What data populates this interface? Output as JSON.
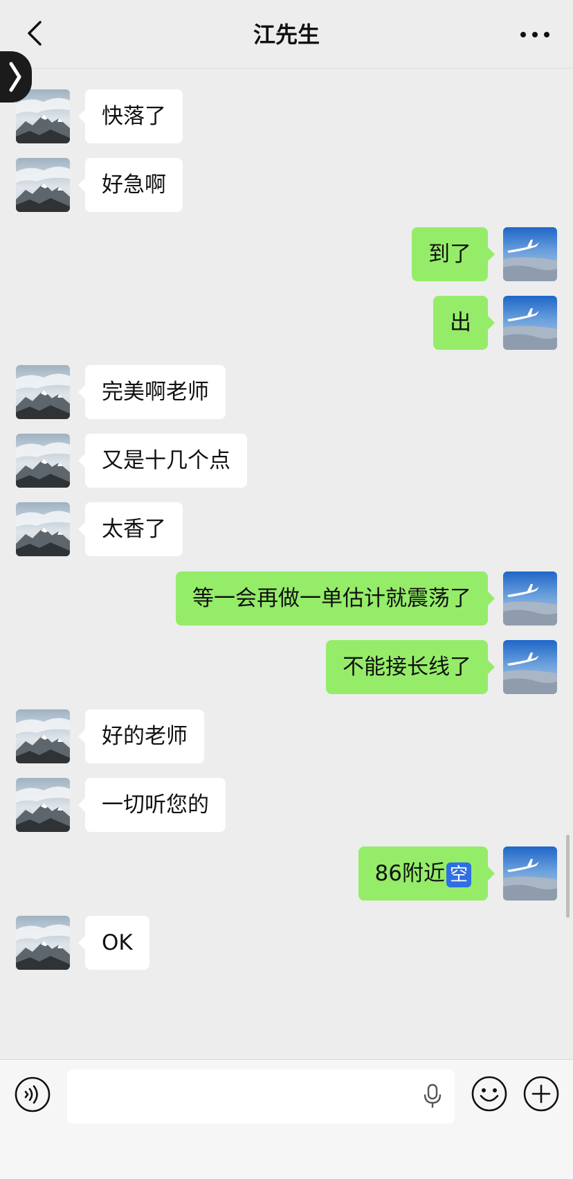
{
  "header": {
    "title": "江先生"
  },
  "colors": {
    "received_bubble": "#ffffff",
    "sent_bubble": "#95ec69",
    "background": "#ededed",
    "badge_blue": "#2f6fe4"
  },
  "icons": {
    "back": "chevron-left-icon",
    "more": "more-dots-icon",
    "voice": "voice-icon",
    "mic": "microphone-icon",
    "emoji": "emoji-icon",
    "plus": "plus-icon",
    "badge": "kong-badge"
  },
  "messages": [
    {
      "side": "left",
      "text": "快落了"
    },
    {
      "side": "left",
      "text": "好急啊"
    },
    {
      "side": "right",
      "text": "到了"
    },
    {
      "side": "right",
      "text": "出"
    },
    {
      "side": "left",
      "text": "完美啊老师"
    },
    {
      "side": "left",
      "text": "又是十几个点"
    },
    {
      "side": "left",
      "text": "太香了"
    },
    {
      "side": "right",
      "text": "等一会再做一单估计就震荡了"
    },
    {
      "side": "right",
      "text": "不能接长线了"
    },
    {
      "side": "left",
      "text": "好的老师"
    },
    {
      "side": "left",
      "text": "一切听您的"
    },
    {
      "side": "right",
      "text": "86附近",
      "badge": "空"
    },
    {
      "side": "left",
      "text": "OK"
    }
  ],
  "input": {
    "value": ""
  }
}
